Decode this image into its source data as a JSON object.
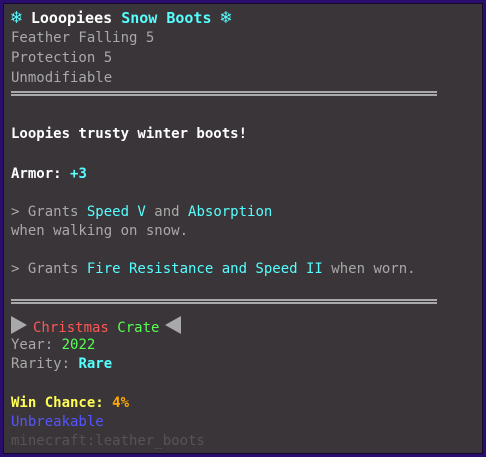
{
  "colors": {
    "background": "#3a3538",
    "border": "#2a0e6e",
    "gray": "#a9a9a9",
    "aqua": "#55ffff",
    "red": "#ff5555",
    "green": "#55ff55",
    "yellow": "#ffff55",
    "gold": "#ffaa00",
    "blue": "#5555ff",
    "dark_gray": "#555555"
  },
  "item": {
    "snowflake": "❄",
    "name_white": "Looopiees",
    "name_aqua": "Snow Boots",
    "enchants": [
      "Feather Falling 5",
      "Protection 5"
    ],
    "modifier": "Unmodifiable"
  },
  "lore": {
    "description": "Loopies trusty winter boots!",
    "armor_label": "Armor:",
    "armor_value": "+3",
    "ability1": {
      "prefix": "> Grants ",
      "effect1": "Speed V",
      "and": " and ",
      "effect2": "Absorption",
      "line2": "when walking on snow."
    },
    "ability2": {
      "prefix": "> Grants ",
      "effects": "Fire Resistance and Speed II",
      "suffix": " when worn."
    }
  },
  "crate": {
    "name_red": "Christmas",
    "name_green": "Crate",
    "year_label": "Year:",
    "year_value": "2022",
    "rarity_label": "Rarity:",
    "rarity_value": "Rare",
    "win_chance_label": "Win Chance:",
    "win_chance_value": "4%"
  },
  "footer": {
    "unbreakable": "Unbreakable",
    "item_id": "minecraft:leather_boots"
  }
}
